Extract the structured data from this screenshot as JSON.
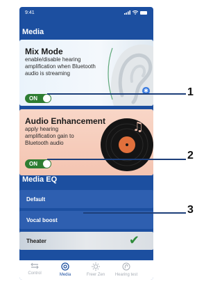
{
  "status_bar": {
    "time": "9:41",
    "signal": "signal-icon",
    "wifi": "wifi-icon",
    "battery": "battery-icon"
  },
  "media": {
    "title": "Media",
    "mix_mode": {
      "title": "Mix Mode",
      "description": "enable/disable hearing amplification when Bluetooth audio is streaming",
      "toggle": "ON",
      "image": "ear-icon",
      "badge": "bluetooth-icon"
    },
    "audio_enhancement": {
      "title": "Audio Enhancement",
      "description": "apply hearing amplification gain to Bluetooth audio",
      "toggle": "ON",
      "image": "vinyl-record-icon"
    }
  },
  "media_eq": {
    "title": "Media  EQ",
    "items": [
      {
        "label": "Default",
        "selected": false
      },
      {
        "label": "Vocal boost",
        "selected": false
      },
      {
        "label": "Theater",
        "selected": true
      }
    ]
  },
  "tabbar": {
    "items": [
      {
        "label": "Control",
        "icon": "sliders-icon",
        "active": false
      },
      {
        "label": "Media",
        "icon": "media-icon",
        "active": true
      },
      {
        "label": "Freer Zen",
        "icon": "zen-icon",
        "active": false
      },
      {
        "label": "Hearing test",
        "icon": "hearing-test-icon",
        "active": false
      }
    ]
  },
  "callouts": [
    "1",
    "2",
    "3"
  ],
  "colors": {
    "panel": "#1c4fa0",
    "toggle_on": "#2e7d32",
    "eq_item": "#2e5fb0",
    "tab_active": "#1c4fa0"
  }
}
